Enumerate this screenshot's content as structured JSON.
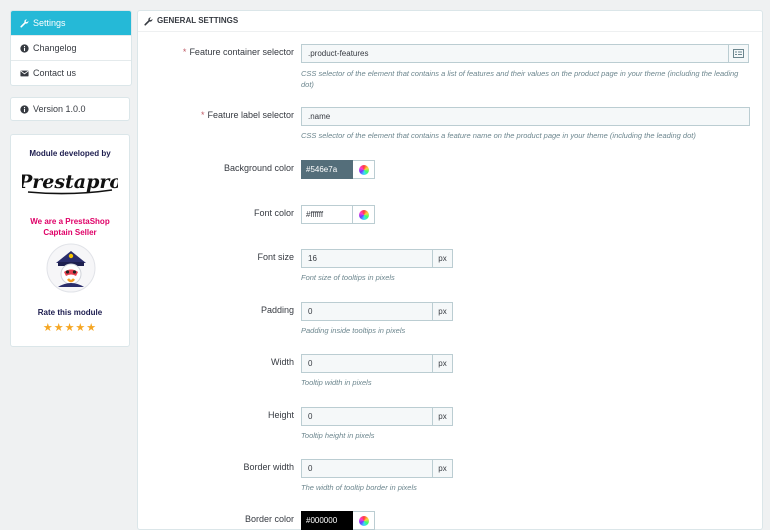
{
  "sidebar": {
    "items": [
      {
        "label": "Settings",
        "icon": "wrench-icon"
      },
      {
        "label": "Changelog",
        "icon": "info-icon"
      },
      {
        "label": "Contact us",
        "icon": "envelope-icon"
      }
    ]
  },
  "version": {
    "label": "Version 1.0.0",
    "icon": "info-icon"
  },
  "promo": {
    "developed_by": "Module developed by",
    "logo_text": "Prestapro",
    "seller_text": "We are a PrestaShop Captain Seller",
    "rate_text": "Rate this module",
    "stars": "★★★★★",
    "rating": 5
  },
  "panel": {
    "title": "GENERAL SETTINGS",
    "fields": {
      "container_selector": {
        "label": "Feature container selector",
        "value": ".product-features",
        "help": "CSS selector of the element that contains a list of features and their values on the product page in your theme (including the leading dot)"
      },
      "label_selector": {
        "label": "Feature label selector",
        "value": ".name",
        "help": "CSS selector of the element that contains a feature name on the product page in your theme (including the leading dot)"
      },
      "bg_color": {
        "label": "Background color",
        "value": "#546e7a"
      },
      "font_color": {
        "label": "Font color",
        "value": "#ffffff"
      },
      "font_size": {
        "label": "Font size",
        "value": "16",
        "unit": "px",
        "help": "Font size of tooltips in pixels"
      },
      "padding": {
        "label": "Padding",
        "value": "0",
        "unit": "px",
        "help": "Padding inside tooltips in pixels"
      },
      "width": {
        "label": "Width",
        "value": "0",
        "unit": "px",
        "help": "Tooltip width in pixels"
      },
      "height": {
        "label": "Height",
        "value": "0",
        "unit": "px",
        "help": "Tooltip height in pixels"
      },
      "border_width": {
        "label": "Border width",
        "value": "0",
        "unit": "px",
        "help": "The width of tooltip border in pixels"
      },
      "border_color": {
        "label": "Border color",
        "value": "#000000"
      }
    }
  },
  "colors": {
    "accent": "#25b9d7",
    "required": "#c05c67",
    "brand_pink": "#df0067"
  }
}
